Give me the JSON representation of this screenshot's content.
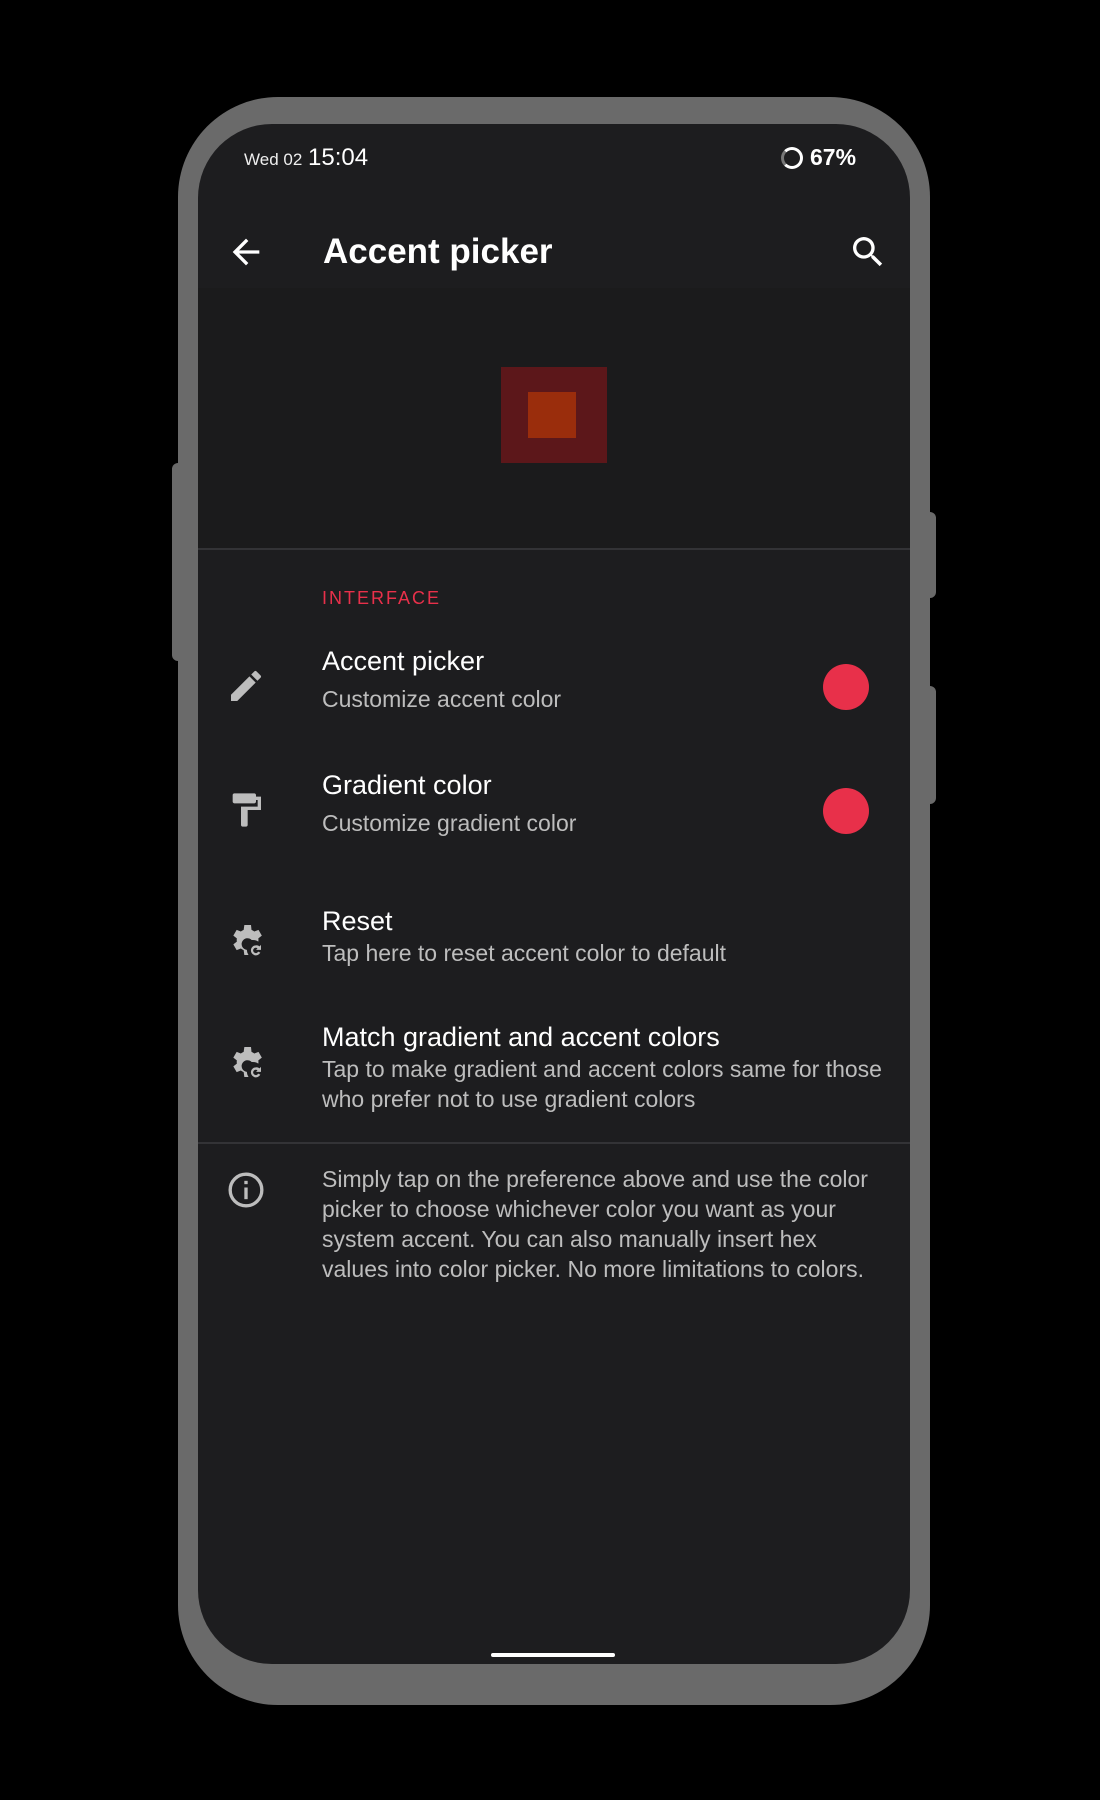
{
  "status_bar": {
    "day": "Wed 02",
    "time": "15:04",
    "battery": "67%"
  },
  "toolbar": {
    "title": "Accent picker",
    "back_icon": "arrow-left-icon",
    "search_icon": "search-icon"
  },
  "preview": {
    "outer_color": "#5c171a",
    "inner_color": "#9a2d0c"
  },
  "section": {
    "header": "INTERFACE"
  },
  "preferences": [
    {
      "title": "Accent picker",
      "subtitle": "Customize accent color",
      "icon": "pencil-icon",
      "color": "#e8304a"
    },
    {
      "title": "Gradient color",
      "subtitle": "Customize gradient color",
      "icon": "paint-roller-icon",
      "color": "#e8304a"
    },
    {
      "title": "Reset",
      "subtitle": "Tap here to reset accent color to default",
      "icon": "gear-reset-icon"
    },
    {
      "title": "Match gradient and accent colors",
      "subtitle": "Tap to make gradient and accent colors same for those who prefer not to use gradient colors",
      "icon": "gear-reset-icon"
    }
  ],
  "info": {
    "icon": "info-icon",
    "text": "Simply tap on the preference above and use the color picker to choose whichever color you want as your system accent. You can also manually insert hex values into color picker. No more limitations to colors."
  },
  "colors": {
    "accent": "#e8304a",
    "background": "#1d1d1f",
    "frame": "#6a6a6a"
  }
}
